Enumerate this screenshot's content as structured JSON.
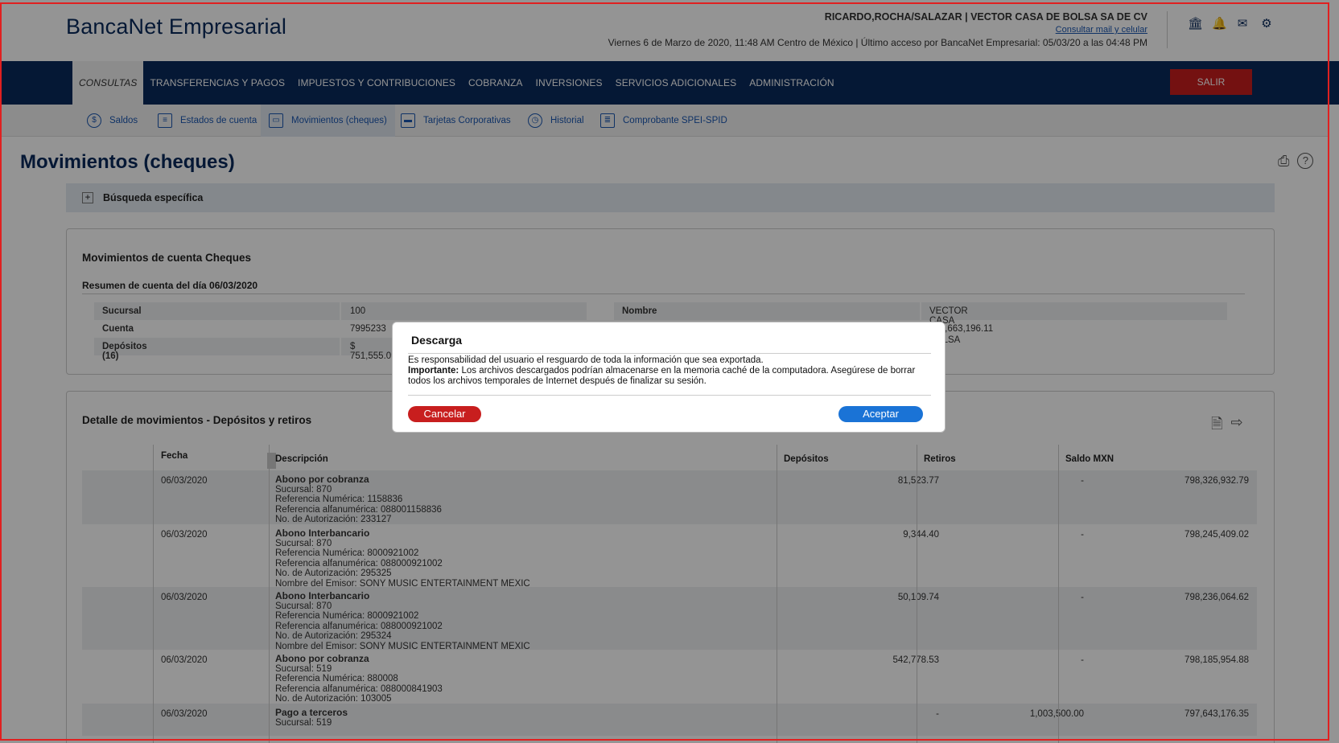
{
  "header": {
    "logo": "BancaNet Empresarial",
    "user": "RICARDO,ROCHA/SALAZAR | VECTOR CASA DE BOLSA SA DE CV",
    "mail_link": "Consultar mail y celular",
    "date_line": "Viernes 6 de Marzo de 2020, 11:48 AM Centro de México | Último acceso por BancaNet Empresarial: 05/03/20 a las 04:48 PM",
    "icons": [
      "bank-icon",
      "bell-icon",
      "mail-icon",
      "gear-icon"
    ]
  },
  "nav": {
    "items": [
      "CONSULTAS",
      "TRANSFERENCIAS Y PAGOS",
      "IMPUESTOS Y CONTRIBUCIONES",
      "COBRANZA",
      "INVERSIONES",
      "SERVICIOS ADICIONALES",
      "ADMINISTRACIÓN"
    ],
    "logout": "SALIR"
  },
  "subnav": {
    "items": [
      "Saldos",
      "Estados de cuenta",
      "Movimientos (cheques)",
      "Tarjetas Corporativas",
      "Historial",
      "Comprobante SPEI-SPID"
    ]
  },
  "page": {
    "title": "Movimientos (cheques)",
    "search_label": "Búsqueda específica"
  },
  "summary": {
    "title": "Movimientos de cuenta Cheques",
    "subtitle": "Resumen de cuenta del día 06/03/2020",
    "rows": [
      {
        "k": "Sucursal",
        "v": "100"
      },
      {
        "k": "Cuenta",
        "v": "7995233"
      },
      {
        "k": "Depósitos (16)",
        "v": "$ 751,555.0"
      }
    ],
    "right_rows": [
      {
        "k": "Nombre",
        "v": "VECTOR CASA DE BOLSA S A."
      },
      {
        "k": "",
        "v": "605,663,196.11"
      }
    ]
  },
  "detail": {
    "title": "Detalle de movimientos - Depósitos y retiros",
    "columns": {
      "fecha": "Fecha",
      "descripcion": "Descripción",
      "depositos": "Depósitos",
      "retiros": "Retiros",
      "saldo": "Saldo MXN"
    },
    "rows": [
      {
        "fecha": "06/03/2020",
        "titulo": "Abono por cobranza",
        "lineas": [
          "Sucursal: 870",
          "Referencia Numérica: 1158836",
          "Referencia alfanumérica: 088001158836",
          "No. de Autorización: 233127"
        ],
        "dep": "81,523.77",
        "ret": "-",
        "saldo": "798,326,932.79"
      },
      {
        "fecha": "06/03/2020",
        "titulo": "Abono Interbancario",
        "lineas": [
          "Sucursal: 870",
          "Referencia Numérica: 8000921002",
          "Referencia alfanumérica: 088000921002",
          "No. de Autorización: 295325",
          "Nombre del Emisor: SONY MUSIC ENTERTAINMENT MEXIC"
        ],
        "dep": "9,344.40",
        "ret": "-",
        "saldo": "798,245,409.02"
      },
      {
        "fecha": "06/03/2020",
        "titulo": "Abono Interbancario",
        "lineas": [
          "Sucursal: 870",
          "Referencia Numérica: 8000921002",
          "Referencia alfanumérica: 088000921002",
          "No. de Autorización: 295324",
          "Nombre del Emisor: SONY MUSIC ENTERTAINMENT MEXIC"
        ],
        "dep": "50,109.74",
        "ret": "-",
        "saldo": "798,236,064.62"
      },
      {
        "fecha": "06/03/2020",
        "titulo": "Abono por cobranza",
        "lineas": [
          "Sucursal: 519",
          "Referencia Numérica: 880008",
          "Referencia alfanumérica: 088000841903",
          "No. de Autorización: 103005"
        ],
        "dep": "542,778.53",
        "ret": "-",
        "saldo": "798,185,954.88"
      },
      {
        "fecha": "06/03/2020",
        "titulo": "Pago a terceros",
        "lineas": [
          "Sucursal: 519"
        ],
        "dep": "-",
        "ret": "1,003,500.00",
        "saldo": "797,643,176.35"
      }
    ]
  },
  "modal": {
    "title": "Descarga",
    "line1": "Es responsabilidad del usuario el resguardo de toda la información que sea exportada.",
    "important_label": "Importante:",
    "line2": "Los archivos descargados podrían almacenarse en la memoria caché de la computadora. Asegúrese de borrar todos los archivos temporales de Internet después de finalizar su sesión.",
    "cancel": "Cancelar",
    "accept": "Aceptar"
  }
}
